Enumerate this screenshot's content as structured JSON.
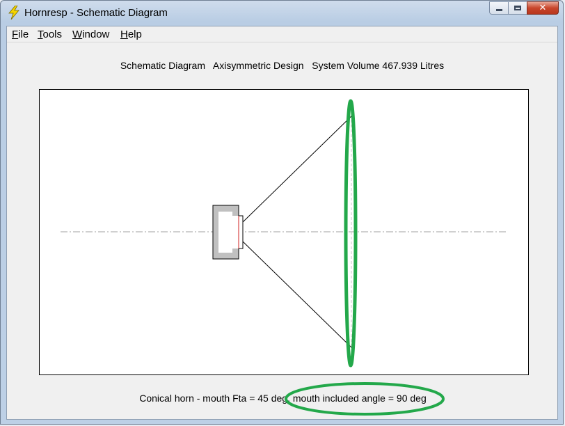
{
  "window": {
    "title": "Hornresp - Schematic Diagram",
    "controls": {
      "minimize": "minimize",
      "maximize": "maximize",
      "close": "close"
    }
  },
  "menu": [
    {
      "hotkey": "F",
      "rest": "ile"
    },
    {
      "hotkey": "T",
      "rest": "ools"
    },
    {
      "hotkey": "W",
      "rest": "indow"
    },
    {
      "hotkey": "H",
      "rest": "elp"
    }
  ],
  "diagram": {
    "heading": "Schematic Diagram   Axisymmetric Design   System Volume 467.939 Litres",
    "caption_part1": "Conical horn - mouth Fta = 45 deg, ",
    "caption_part2": "mouth included angle = 90 deg"
  },
  "colors": {
    "annotation": "#23a84a",
    "driver_body": "#c0c0c0",
    "driver_cone": "#d02020",
    "centerline": "#a0a0a0"
  },
  "icons": {
    "app": "lightning-bolt-icon",
    "minimize": "minimize-icon",
    "maximize": "maximize-icon",
    "close": "close-icon"
  }
}
